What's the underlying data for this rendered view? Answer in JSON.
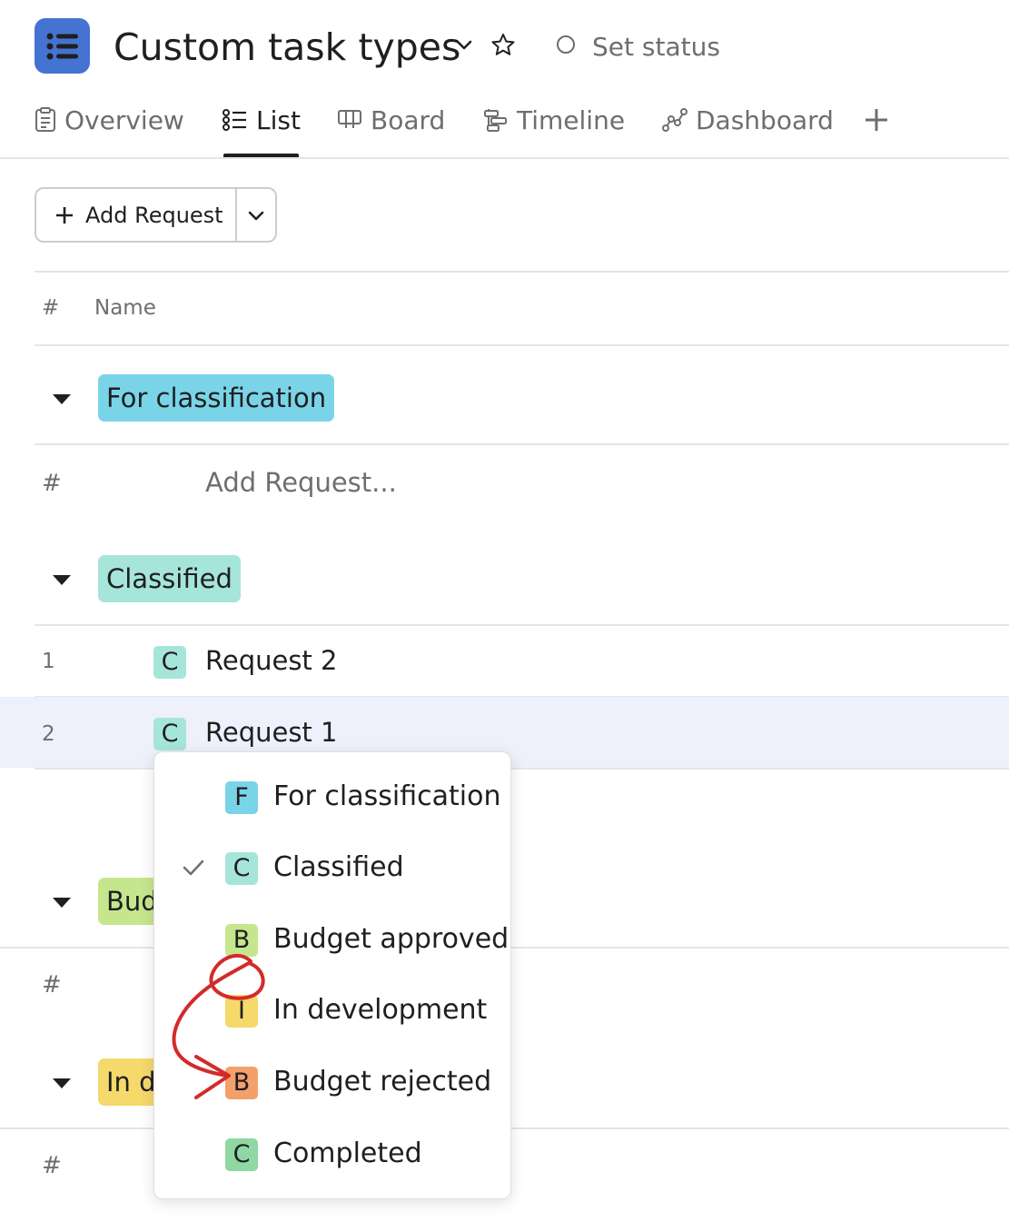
{
  "project": {
    "title": "Custom task types",
    "status_label": "Set status",
    "icon": "list-icon"
  },
  "tabs": [
    {
      "label": "Overview",
      "icon": "overview-icon",
      "active": false
    },
    {
      "label": "List",
      "icon": "list-icon",
      "active": true
    },
    {
      "label": "Board",
      "icon": "board-icon",
      "active": false
    },
    {
      "label": "Timeline",
      "icon": "timeline-icon",
      "active": false
    },
    {
      "label": "Dashboard",
      "icon": "dashboard-icon",
      "active": false
    }
  ],
  "toolbar": {
    "add_label": "Add Request"
  },
  "columns": {
    "number": "#",
    "name": "Name"
  },
  "sections": [
    {
      "label": "For classification",
      "color": "#7ad4e8"
    },
    {
      "label": "Classified",
      "color": "#a6e5d9"
    },
    {
      "label": "Bud",
      "color": "#c6e68d"
    },
    {
      "label": "In d",
      "color": "#f5d96b"
    }
  ],
  "add_placeholder": "Add Request...",
  "hash": "#",
  "rows": [
    {
      "number": "1",
      "badge": "C",
      "name": "Request 2"
    },
    {
      "number": "2",
      "badge": "C",
      "name": "Request 1"
    }
  ],
  "menu": {
    "items": [
      {
        "badge": "F",
        "label": "For classification",
        "color": "#7ad4e8",
        "selected": false
      },
      {
        "badge": "C",
        "label": "Classified",
        "color": "#a6e5d9",
        "selected": true
      },
      {
        "badge": "B",
        "label": "Budget approved",
        "color": "#c6e68d",
        "selected": false
      },
      {
        "badge": "I",
        "label": "In development",
        "color": "#f5d96b",
        "selected": false
      },
      {
        "badge": "B",
        "label": "Budget rejected",
        "color": "#f4a06b",
        "selected": false
      },
      {
        "badge": "C",
        "label": "Completed",
        "color": "#8fd7a3",
        "selected": false
      }
    ]
  },
  "colors": {
    "project_icon": "#4573d2",
    "annotation": "#d42a2a",
    "selected_row": "#eef0fb"
  }
}
